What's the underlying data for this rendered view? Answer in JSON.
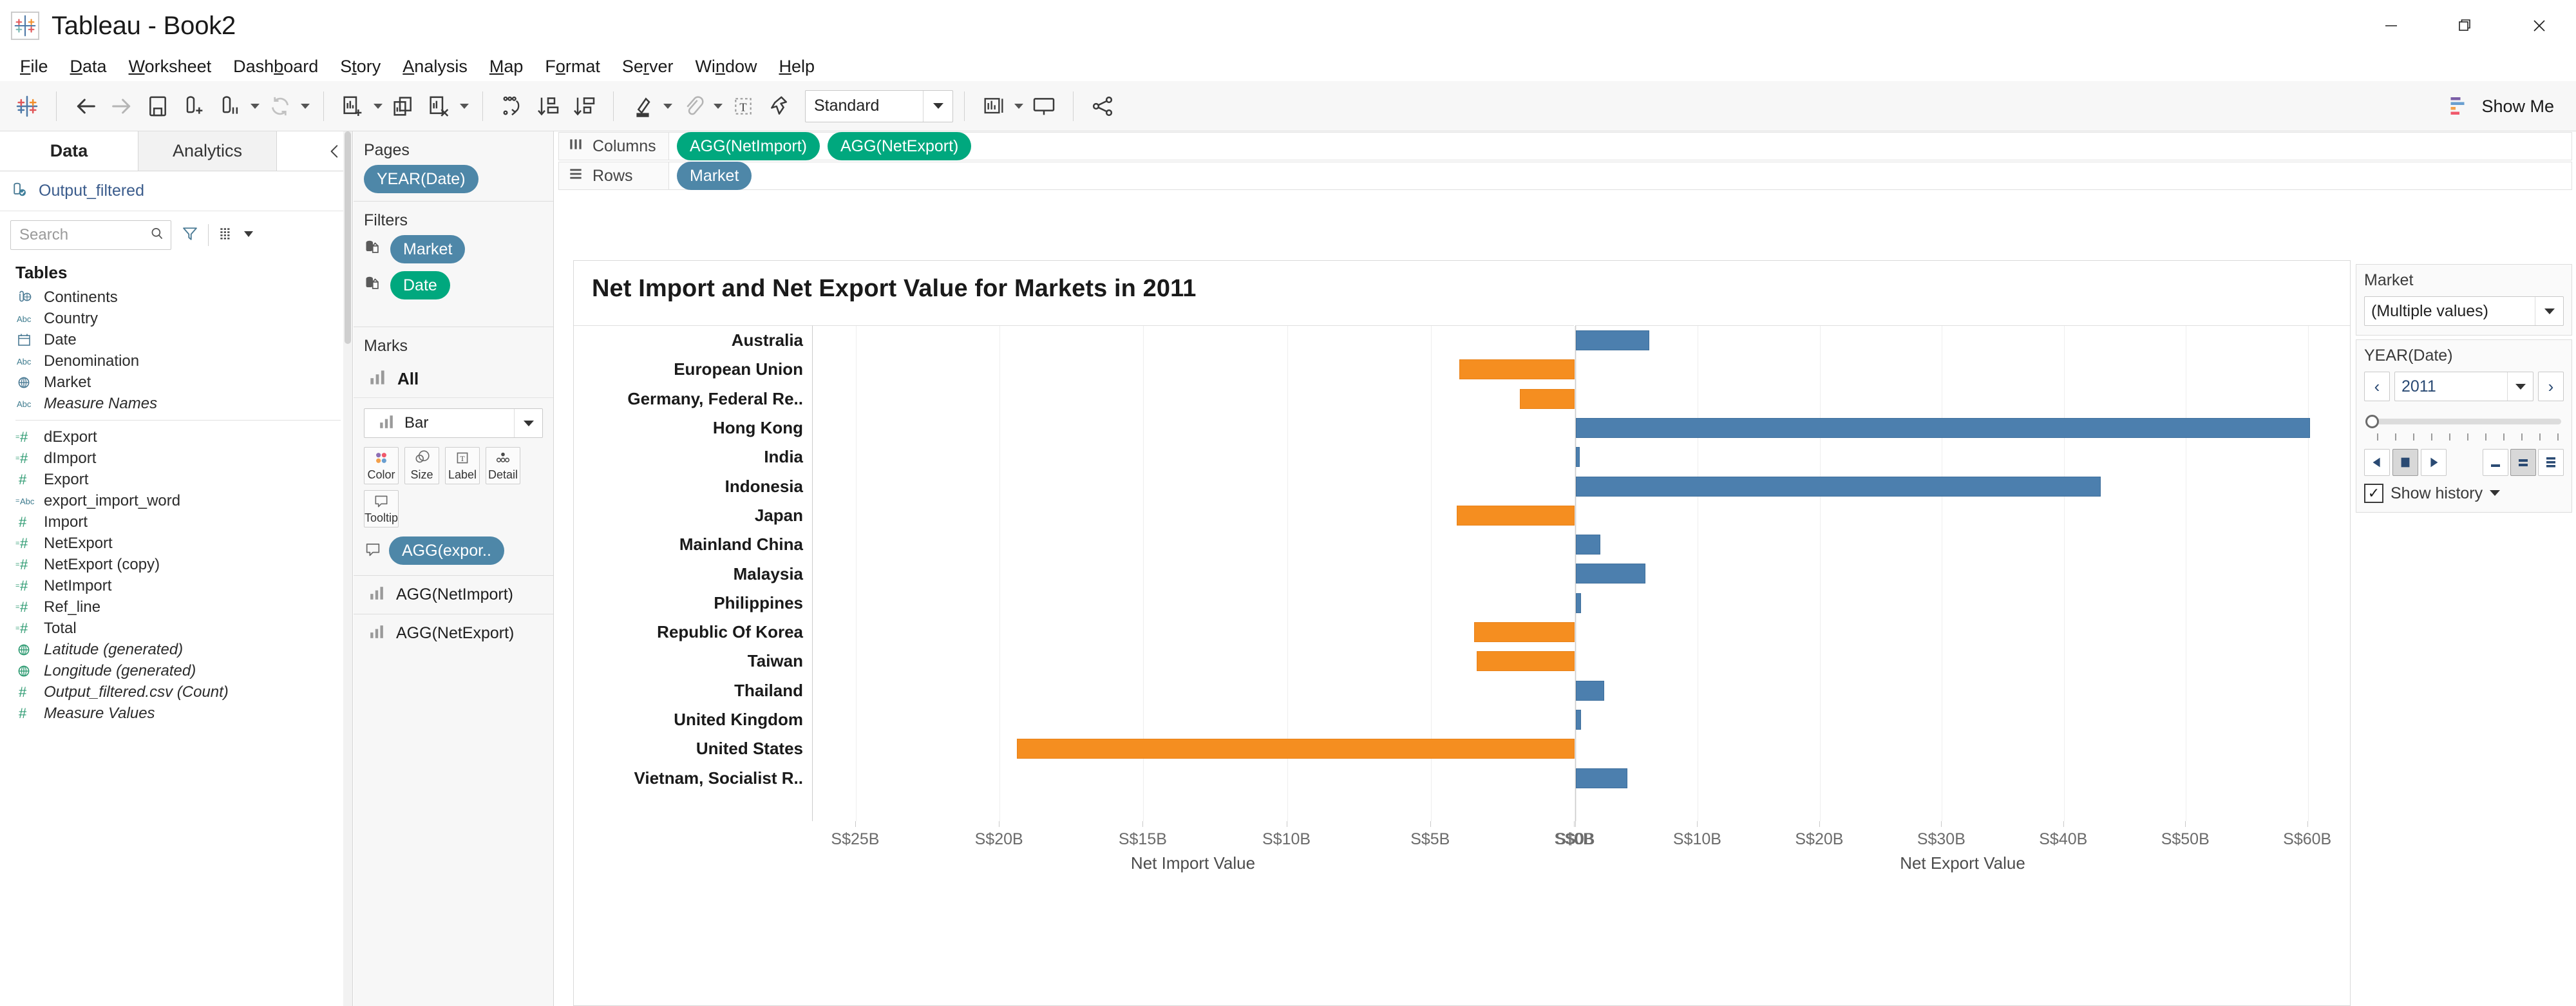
{
  "window": {
    "title": "Tableau - Book2",
    "minimize_label": "minimize-window",
    "restore_label": "restore-window",
    "close_label": "close-window"
  },
  "menubar": {
    "items": [
      {
        "label": "File",
        "accel": "F"
      },
      {
        "label": "Data",
        "accel": "D"
      },
      {
        "label": "Worksheet",
        "accel": "W"
      },
      {
        "label": "Dashboard",
        "accel": "b"
      },
      {
        "label": "Story",
        "accel": "t"
      },
      {
        "label": "Analysis",
        "accel": "A"
      },
      {
        "label": "Map",
        "accel": "M"
      },
      {
        "label": "Format",
        "accel": "o"
      },
      {
        "label": "Server",
        "accel": "r"
      },
      {
        "label": "Window",
        "accel": "n"
      },
      {
        "label": "Help",
        "accel": "H"
      }
    ]
  },
  "toolbar": {
    "icons": [
      "tableau-logo-icon",
      "back-icon",
      "forward-icon",
      "save-icon",
      "new-data-source-icon",
      "pause-data-updates-icon",
      "refresh-data-source-icon",
      "new-worksheet-icon",
      "duplicate-sheet-icon",
      "clear-sheet-icon",
      "swap-rows-columns-icon",
      "sort-ascending-icon",
      "sort-descending-icon",
      "highlight-icon",
      "group-members-icon",
      "show-mark-labels-icon",
      "fix-axes-icon"
    ],
    "fit_value": "Standard",
    "presentation_mode_label": "presentation-mode-icon",
    "share_label": "share-icon",
    "show_me_label": "Show Me"
  },
  "data_pane": {
    "tabs": [
      {
        "label": "Data",
        "active": true
      },
      {
        "label": "Analytics",
        "active": false
      }
    ],
    "collapse_label": "collapse-pane-icon",
    "datasource": "Output_filtered",
    "search": {
      "value": "",
      "placeholder": "Search"
    },
    "tables_heading": "Tables",
    "fields": [
      {
        "label": "Continents",
        "icon": "group-icon",
        "italic": false
      },
      {
        "label": "Country",
        "icon": "abc-icon",
        "italic": false
      },
      {
        "label": "Date",
        "icon": "calendar-icon",
        "italic": false
      },
      {
        "label": "Denomination",
        "icon": "abc-icon",
        "italic": false
      },
      {
        "label": "Market",
        "icon": "geo-globe-icon",
        "italic": false
      },
      {
        "label": "Measure Names",
        "icon": "abc-icon",
        "italic": true
      },
      {
        "divider": true
      },
      {
        "label": "dExport",
        "icon": "calc-number-icon",
        "italic": false
      },
      {
        "label": "dImport",
        "icon": "calc-number-icon",
        "italic": false
      },
      {
        "label": "Export",
        "icon": "number-icon",
        "italic": false
      },
      {
        "label": "export_import_word",
        "icon": "calc-abc-icon",
        "italic": false
      },
      {
        "label": "Import",
        "icon": "number-icon",
        "italic": false
      },
      {
        "label": "NetExport",
        "icon": "calc-number-icon",
        "italic": false
      },
      {
        "label": "NetExport (copy)",
        "icon": "calc-number-icon",
        "italic": false
      },
      {
        "label": "NetImport",
        "icon": "calc-number-icon",
        "italic": false
      },
      {
        "label": "Ref_line",
        "icon": "calc-number-icon",
        "italic": false
      },
      {
        "label": "Total",
        "icon": "calc-number-icon",
        "italic": false
      },
      {
        "label": "Latitude (generated)",
        "icon": "geo-green-icon",
        "italic": true
      },
      {
        "label": "Longitude (generated)",
        "icon": "geo-green-icon",
        "italic": true
      },
      {
        "label": "Output_filtered.csv (Count)",
        "icon": "number-icon",
        "italic": true
      },
      {
        "label": "Measure Values",
        "icon": "number-icon",
        "italic": true
      }
    ]
  },
  "shelf_column": {
    "pages": {
      "title": "Pages",
      "pill": "YEAR(Date)",
      "pill_color": "blue"
    },
    "filters": {
      "title": "Filters",
      "pills": [
        {
          "label": "Market",
          "color": "blue",
          "icon": "context-filter-icon"
        },
        {
          "label": "Date",
          "color": "green",
          "icon": "context-filter-icon"
        }
      ]
    },
    "marks": {
      "title": "Marks",
      "all_label": "All",
      "mark_type": "Bar",
      "buttons": [
        {
          "label": "Color",
          "icon": "color-palette-icon"
        },
        {
          "label": "Size",
          "icon": "size-circles-icon"
        },
        {
          "label": "Label",
          "icon": "label-T-icon"
        },
        {
          "label": "Detail",
          "icon": "detail-dots-icon"
        },
        {
          "label": "Tooltip",
          "icon": "tooltip-bubble-icon"
        }
      ],
      "tooltip_pill": {
        "label": "AGG(expor..",
        "color": "blue",
        "icon": "tooltip-bubble-icon"
      },
      "measure_cards": [
        {
          "label": "AGG(NetImport)",
          "icon": "bar-mark-icon"
        },
        {
          "label": "AGG(NetExport)",
          "icon": "bar-mark-icon"
        }
      ]
    }
  },
  "shelves": {
    "columns": {
      "label": "Columns",
      "icon": "columns-icon",
      "pills": [
        {
          "label": "AGG(NetImport)",
          "color": "green"
        },
        {
          "label": "AGG(NetExport)",
          "color": "green"
        }
      ]
    },
    "rows": {
      "label": "Rows",
      "icon": "rows-icon",
      "pills": [
        {
          "label": "Market",
          "color": "blue"
        }
      ]
    }
  },
  "right_panel": {
    "market_filter": {
      "title": "Market",
      "value": "(Multiple values)",
      "dropdown_icon": "chevron-down-icon"
    },
    "year_filter": {
      "title": "YEAR(Date)",
      "prev_label": "‹",
      "next_label": "›",
      "value": "2011",
      "show_history_label": "Show history",
      "show_history_checked": "✓",
      "play_icon": "play-backward-icon",
      "stop_icon": "stop-icon",
      "forward_icon": "play-forward-icon",
      "speed_slow_icon": "speed-slow-icon",
      "speed_medium_icon": "speed-medium-icon",
      "speed_fast_icon": "speed-fast-icon"
    }
  },
  "chart_data": {
    "type": "bar",
    "title": "Net Import and Net Export Value for Markets in  2011",
    "orientation": "horizontal",
    "grid": true,
    "legend": null,
    "panels": [
      {
        "name": "Net Import Value",
        "xlabel": "Net Import Value",
        "xticks": [
          "S$25B",
          "S$20B",
          "S$15B",
          "S$10B",
          "S$5B",
          "S$0B"
        ],
        "xtick_values": [
          25,
          20,
          15,
          10,
          5,
          0
        ],
        "xlim": [
          26.5,
          0
        ],
        "reversed": true,
        "unit": "S$ billions",
        "bar_color": "#f58e20"
      },
      {
        "name": "Net Export Value",
        "xlabel": "Net Export Value",
        "xticks": [
          "S$0B",
          "S$10B",
          "S$20B",
          "S$30B",
          "S$40B",
          "S$50B",
          "S$60B"
        ],
        "xtick_values": [
          0,
          10,
          20,
          30,
          40,
          50,
          60
        ],
        "xlim": [
          0,
          63.5
        ],
        "reversed": false,
        "unit": "S$ billions",
        "bar_color": "#4c7fae"
      }
    ],
    "categories": [
      "Australia",
      "European Union",
      "Germany, Federal Re..",
      "Hong Kong",
      "India",
      "Indonesia",
      "Japan",
      "Mainland China",
      "Malaysia",
      "Philippines",
      "Republic Of Korea",
      "Taiwan",
      "Thailand",
      "United Kingdom",
      "United States",
      "Vietnam, Socialist R.."
    ],
    "series": [
      {
        "name": "Net Import Value",
        "panel": 0,
        "color": "#f58e20",
        "values": [
          0,
          4.0,
          1.9,
          0,
          0,
          0,
          4.1,
          0,
          0,
          0,
          3.5,
          3.4,
          0,
          0,
          19.4,
          0
        ]
      },
      {
        "name": "Net Export Value",
        "panel": 1,
        "color": "#4c7fae",
        "values": [
          6.0,
          0,
          0,
          60.2,
          0.3,
          43.0,
          0,
          2.0,
          5.7,
          0.4,
          0,
          0,
          2.3,
          0.4,
          0,
          4.2
        ]
      }
    ]
  }
}
